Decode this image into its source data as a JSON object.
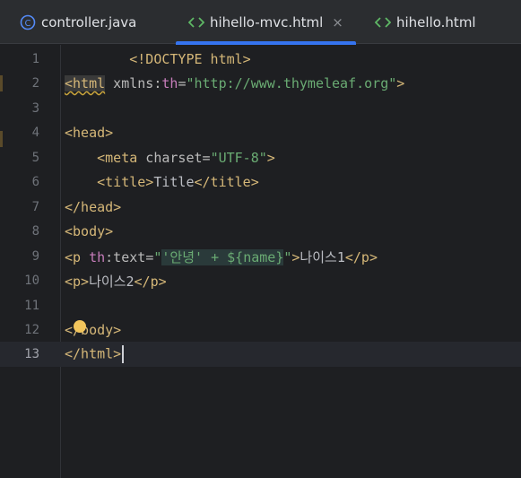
{
  "tabs": [
    {
      "label": "controller.java",
      "icon": "java-class-icon",
      "active": false
    },
    {
      "label": "hihello-mvc.html",
      "icon": "html-file-icon",
      "active": true,
      "close": "×"
    },
    {
      "label": "hihello.html",
      "icon": "html-file-icon",
      "active": false
    }
  ],
  "colors": {
    "accent": "#3574f0",
    "tag": "#d5b778",
    "string": "#6aab73",
    "namespace": "#c77dbb",
    "text": "#bcbec4"
  },
  "editor": {
    "current_line": 13,
    "lines": [
      {
        "n": "1",
        "p": [
          "<!DOCTYPE html>"
        ]
      },
      {
        "n": "2",
        "p": [
          "<html",
          " xmlns",
          ":",
          "th",
          "=",
          "\"http://www.thymeleaf.org\"",
          ">"
        ]
      },
      {
        "n": "3",
        "p": []
      },
      {
        "n": "4",
        "p": [
          "<head>"
        ]
      },
      {
        "n": "5",
        "p": [
          "    ",
          "<meta",
          " charset",
          "=",
          "\"UTF-8\"",
          ">"
        ]
      },
      {
        "n": "6",
        "p": [
          "    ",
          "<title>",
          "Title",
          "</title>"
        ]
      },
      {
        "n": "7",
        "p": [
          "</head>"
        ]
      },
      {
        "n": "8",
        "p": [
          "<body>"
        ]
      },
      {
        "n": "9",
        "p": [
          "<p",
          " ",
          "th",
          ":text",
          "=",
          "\"",
          "'안녕' + ${name}",
          "\"",
          ">",
          "나이스1",
          "</p>"
        ]
      },
      {
        "n": "10",
        "p": [
          "<p>",
          "나이스2",
          "</p>"
        ]
      },
      {
        "n": "11",
        "p": []
      },
      {
        "n": "12",
        "p": [
          "</body>"
        ]
      },
      {
        "n": "13",
        "p": [
          "</html>"
        ]
      }
    ]
  }
}
